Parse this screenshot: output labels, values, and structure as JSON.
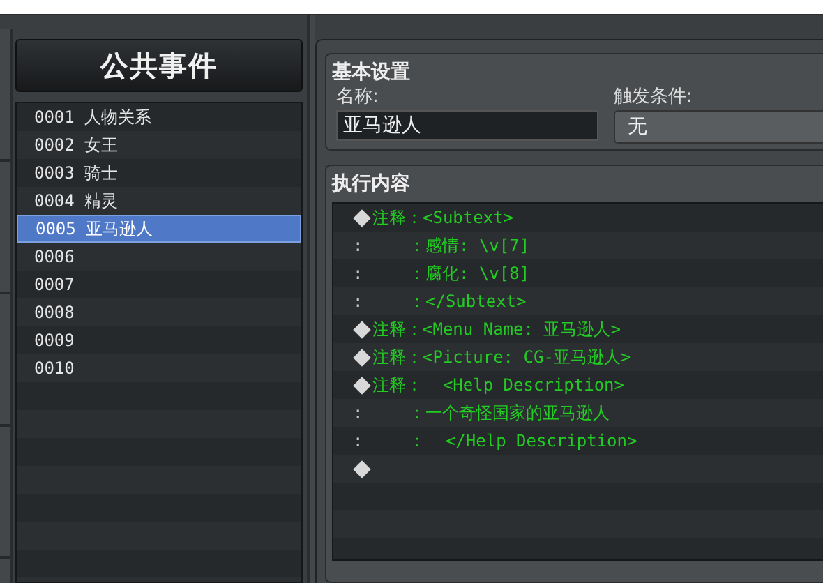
{
  "events_panel": {
    "title": "公共事件",
    "items": [
      {
        "number": "0001",
        "name": "人物关系",
        "selected": false
      },
      {
        "number": "0002",
        "name": "女王",
        "selected": false
      },
      {
        "number": "0003",
        "name": "骑士",
        "selected": false
      },
      {
        "number": "0004",
        "name": "精灵",
        "selected": false
      },
      {
        "number": "0005",
        "name": "亚马逊人",
        "selected": true
      },
      {
        "number": "0006",
        "selected": false
      },
      {
        "number": "0007",
        "selected": false
      },
      {
        "number": "0008",
        "selected": false
      },
      {
        "number": "0009",
        "selected": false
      },
      {
        "number": "0010",
        "selected": false
      }
    ]
  },
  "basic_settings": {
    "title": "基本设置",
    "name_label": "名称:",
    "name_value": "亚马逊人",
    "trigger_label": "触发条件:",
    "trigger_value": "无"
  },
  "contents": {
    "title": "执行内容",
    "lines": [
      {
        "kind": "comment",
        "label": "注释",
        "text": "：<Subtext>"
      },
      {
        "kind": "continuation",
        "lead": ":",
        "text": "：感情: \\v[7]"
      },
      {
        "kind": "continuation",
        "lead": ":",
        "text": "：腐化: \\v[8]"
      },
      {
        "kind": "continuation",
        "lead": ":",
        "text": "：</Subtext>"
      },
      {
        "kind": "comment",
        "label": "注释",
        "text": "：<Menu Name: 亚马逊人>"
      },
      {
        "kind": "comment",
        "label": "注释",
        "text": "：<Picture: CG-亚马逊人>"
      },
      {
        "kind": "comment",
        "label": "注释",
        "text": "：  <Help Description>"
      },
      {
        "kind": "continuation",
        "lead": ":",
        "text": "：一个奇怪国家的亚马逊人"
      },
      {
        "kind": "continuation",
        "lead": ":",
        "text": "：  </Help Description>"
      },
      {
        "kind": "empty"
      }
    ]
  }
}
